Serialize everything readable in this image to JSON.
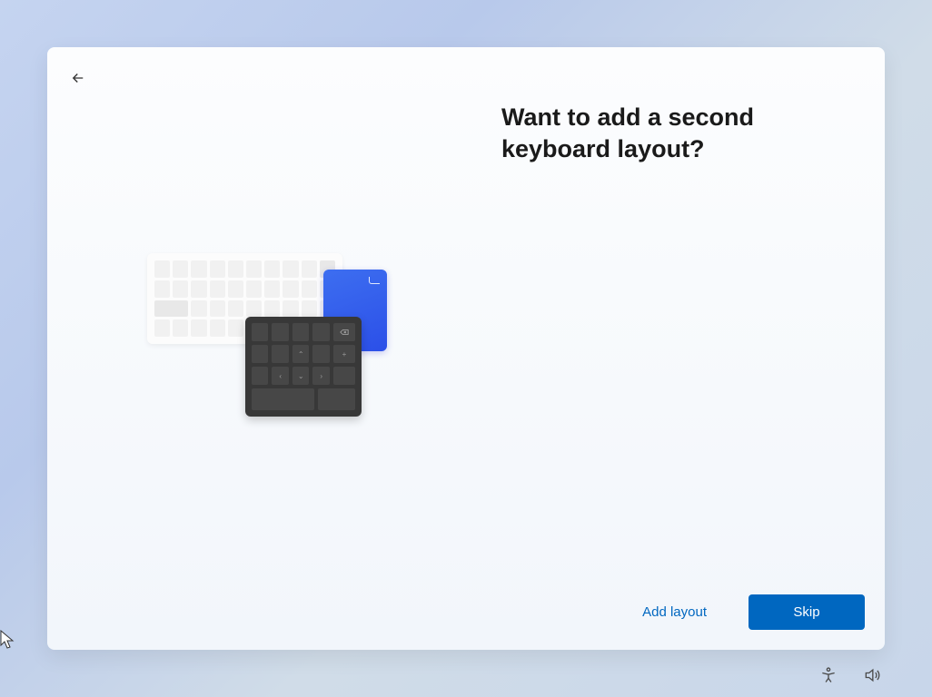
{
  "heading": "Want to add a second keyboard layout?",
  "buttons": {
    "add_layout": "Add layout",
    "skip": "Skip"
  },
  "icons": {
    "back": "back-arrow-icon",
    "accessibility": "accessibility-icon",
    "volume": "volume-icon"
  }
}
